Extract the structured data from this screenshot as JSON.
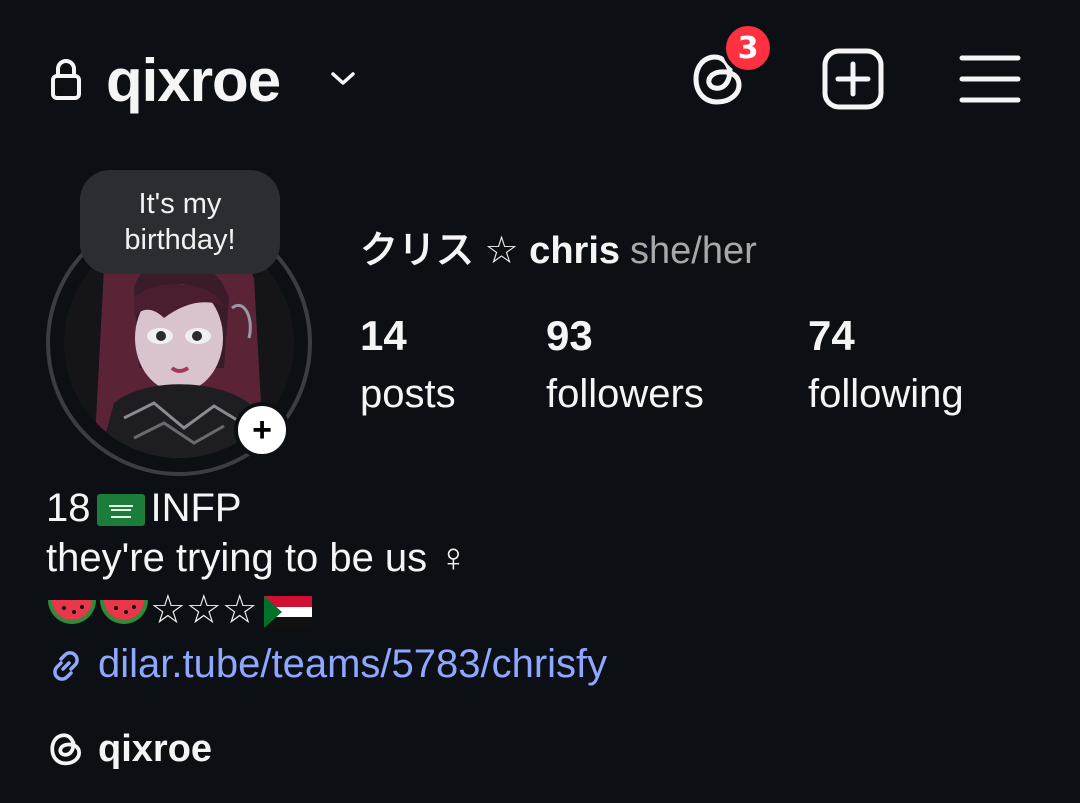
{
  "header": {
    "username": "qixroe",
    "notification_count": "3",
    "icons": [
      "lock-icon",
      "chevron-down-icon",
      "threads-icon",
      "add-square-icon",
      "menu-icon"
    ]
  },
  "profile": {
    "note": "It's my\nbirthday!",
    "display_name": "クリス ☆ chris",
    "pronouns": "she/her",
    "add_story_symbol": "+"
  },
  "stats": {
    "posts": {
      "value": "14",
      "label": "posts"
    },
    "followers": {
      "value": "93",
      "label": "followers"
    },
    "following": {
      "value": "74",
      "label": "following"
    }
  },
  "bio": {
    "line1_a": "18",
    "line1_b": "INFP",
    "line2": "they're trying to be us ♀",
    "line3_stars": "☆☆☆",
    "link": "dilar.tube/teams/5783/chrisfy"
  },
  "threads": {
    "handle": "qixroe"
  },
  "colors": {
    "background": "#0c1014",
    "badge": "#ff3040",
    "link": "#8fa7ff",
    "pronouns": "#a8a8a8"
  }
}
